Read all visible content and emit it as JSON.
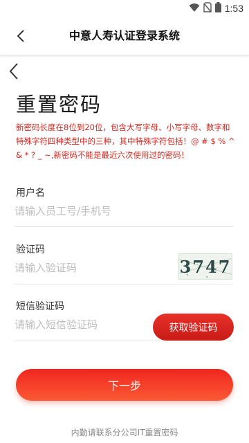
{
  "status_bar": {
    "time": "1:53",
    "icons": [
      "wifi-icon",
      "no-sim-icon",
      "battery-icon"
    ]
  },
  "app_bar": {
    "title": "中意人寿认证登录系统",
    "back_icon": "chevron-left-icon"
  },
  "page": {
    "back_icon": "chevron-left-icon",
    "title": "重置密码",
    "rules": "新密码长度在8位到20位，包含大写字母、小写字母、数字和特殊字符四种类型中的三种，其中特殊字符包括！@ # $ % ^ & * ? _ ~,新密码不能是最近六次使用过的密码！"
  },
  "form": {
    "username": {
      "label": "用户名",
      "value": "",
      "placeholder": "请输入员工号/手机号"
    },
    "captcha": {
      "label": "验证码",
      "value": "",
      "placeholder": "请输入验证码",
      "image_text": "3747"
    },
    "sms": {
      "label": "短信验证码",
      "value": "",
      "placeholder": "请输入短信验证码",
      "button_label": "获取验证码"
    }
  },
  "next_button": "下一步",
  "footer_note": "内勤请联系分公司IT重置密码",
  "colors": {
    "accent": "#e8302a",
    "rules_text": "#d0281f"
  }
}
